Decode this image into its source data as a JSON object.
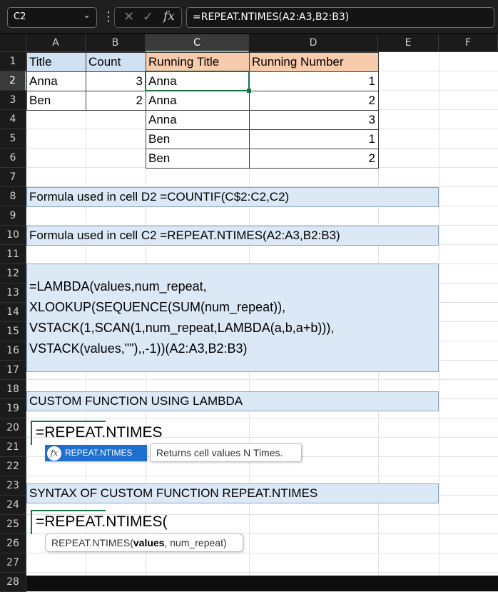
{
  "name_box": "C2",
  "formula_bar": "=REPEAT.NTIMES(A2:A3,B2:B3)",
  "icons": {
    "cancel": "close-icon",
    "enter": "check-icon",
    "function": "fx-icon",
    "dropdown": "chevron-down-icon"
  },
  "fx_label": "fx",
  "columns": [
    "A",
    "B",
    "C",
    "D",
    "E",
    "F"
  ],
  "rows": [
    "1",
    "2",
    "3",
    "4",
    "5",
    "6",
    "7",
    "8",
    "9",
    "10",
    "11",
    "12",
    "13",
    "14",
    "15",
    "16",
    "17",
    "18",
    "19",
    "20",
    "21",
    "22",
    "23",
    "24",
    "25",
    "26",
    "27",
    "28"
  ],
  "table": {
    "headers": [
      "Title",
      "Count",
      "Running Title",
      "Running Number"
    ],
    "source": [
      [
        "Anna",
        "3"
      ],
      [
        "Ben",
        "2"
      ]
    ],
    "running": [
      [
        "Anna",
        "1"
      ],
      [
        "Anna",
        "2"
      ],
      [
        "Anna",
        "3"
      ],
      [
        "Ben",
        "1"
      ],
      [
        "Ben",
        "2"
      ]
    ]
  },
  "notes": {
    "row8": "Formula used in cell D2 =COUNTIF(C$2:C2,C2)",
    "row10": "Formula used in cell C2 =REPEAT.NTIMES(A2:A3,B2:B3)",
    "lambda": [
      "=LAMBDA(values,num_repeat,",
      "XLOOKUP(SEQUENCE(SUM(num_repeat)),",
      "VSTACK(1,SCAN(1,num_repeat,LAMBDA(a,b,a+b))),",
      "VSTACK(values,\"\"),,-1))(A2:A3,B2:B3)"
    ],
    "row19": "CUSTOM FUNCTION USING LAMBDA",
    "row24": "SYNTAX OF CUSTOM FUNCTION REPEAT.NTIMES"
  },
  "autocomplete": {
    "typed": "=REPEAT.NTIMES",
    "item": "REPEAT.NTIMES",
    "description": "Returns cell values N Times."
  },
  "syntax": {
    "typed": "=REPEAT.NTIMES(",
    "fn": "REPEAT.NTIMES(",
    "arg_bold": "values",
    "rest": ", num_repeat)"
  }
}
